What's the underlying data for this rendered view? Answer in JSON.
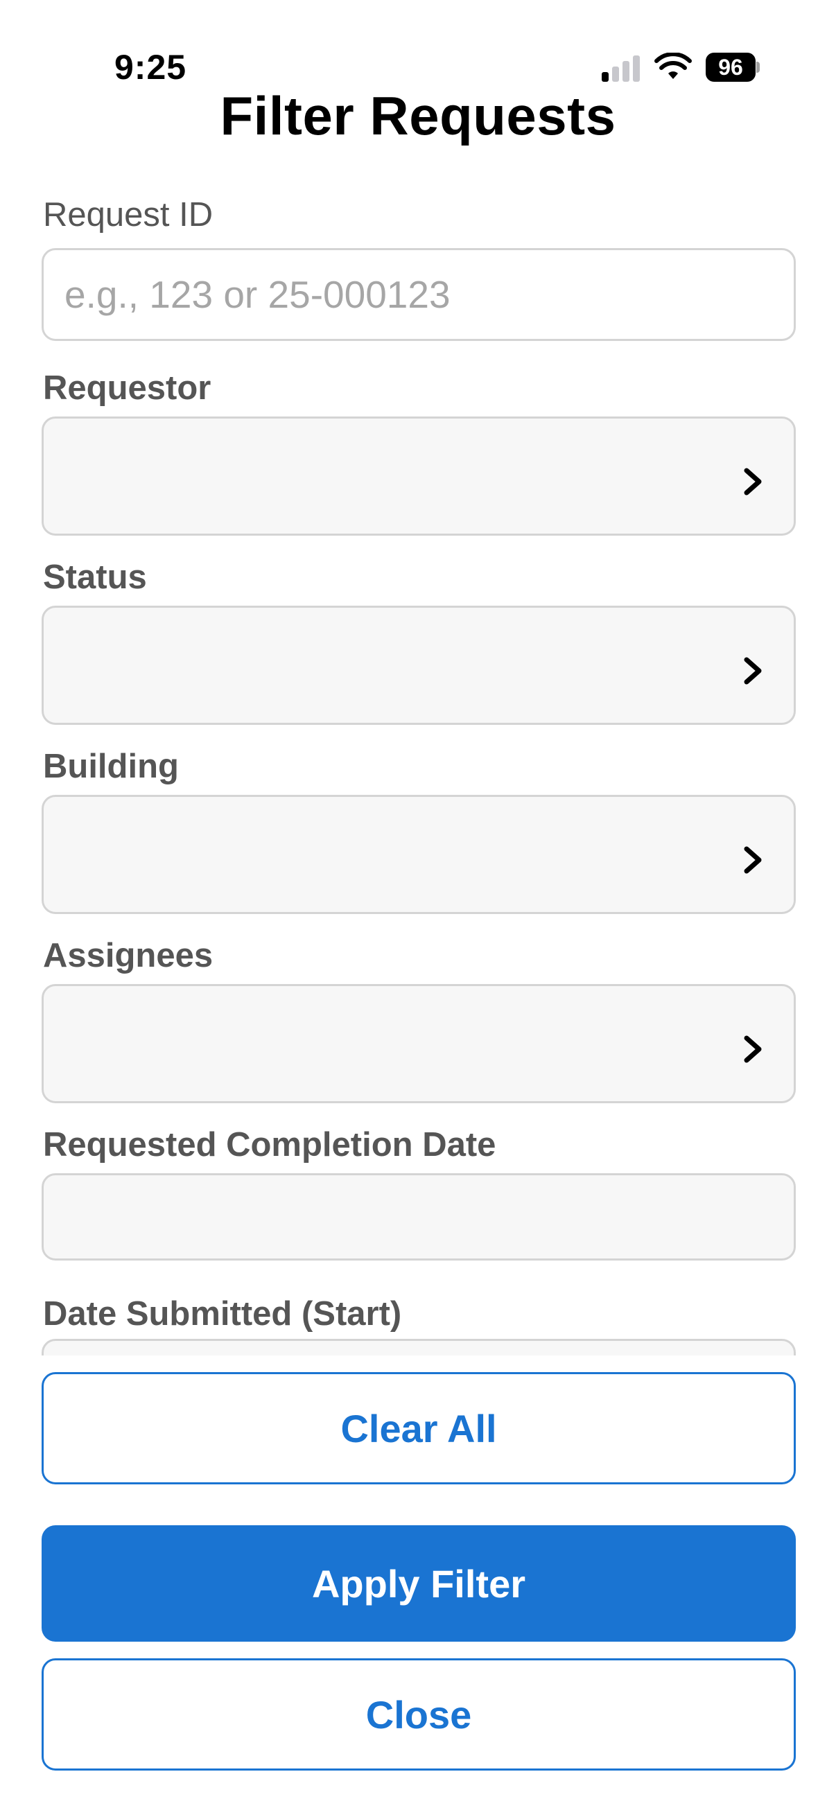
{
  "status_bar": {
    "time": "9:25",
    "battery": "96",
    "signal_bars_active": 1,
    "signal_bars_total": 4
  },
  "title": "Filter Requests",
  "fields": {
    "request_id": {
      "label": "Request ID",
      "placeholder": "e.g., 123 or 25-000123",
      "value": ""
    },
    "requestor": {
      "label": "Requestor",
      "value": ""
    },
    "status": {
      "label": "Status",
      "value": ""
    },
    "building": {
      "label": "Building",
      "value": ""
    },
    "assignees": {
      "label": "Assignees",
      "value": ""
    },
    "requested_completion_date": {
      "label": "Requested Completion Date",
      "value": ""
    },
    "date_submitted_start": {
      "label": "Date Submitted (Start)",
      "value": ""
    }
  },
  "buttons": {
    "clear_all": "Clear All",
    "apply_filter": "Apply Filter",
    "close": "Close"
  },
  "icons": {
    "select_indicator": "chevron-right-icon"
  },
  "colors": {
    "accent": "#1a74d2",
    "label": "#555555",
    "border": "#d4d4d4",
    "select_bg": "#f7f7f7",
    "placeholder": "#a6a6a6"
  }
}
